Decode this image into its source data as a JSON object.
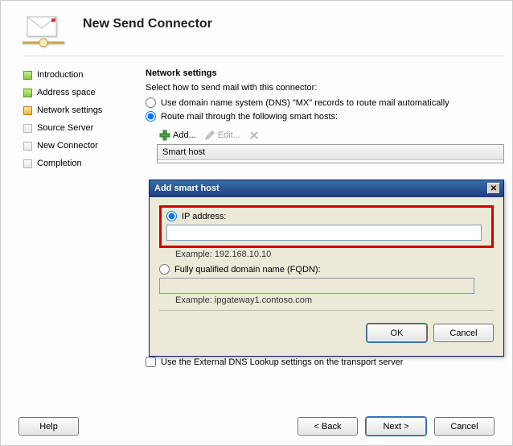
{
  "header": {
    "title": "New Send Connector"
  },
  "sidebar": {
    "steps": [
      {
        "label": "Introduction",
        "state": "green"
      },
      {
        "label": "Address space",
        "state": "green"
      },
      {
        "label": "Network settings",
        "state": "orange"
      },
      {
        "label": "Source Server",
        "state": "grey"
      },
      {
        "label": "New Connector",
        "state": "grey"
      },
      {
        "label": "Completion",
        "state": "grey"
      }
    ]
  },
  "main": {
    "section_title": "Network settings",
    "instruction": "Select how to send mail with this connector:",
    "option_dns": "Use domain name system (DNS) \"MX\" records to route mail automatically",
    "option_smart": "Route mail through the following smart hosts:",
    "toolbar": {
      "add": "Add...",
      "edit": "Edit...",
      "delete": ""
    },
    "table_header": "Smart host",
    "external_dns_label": "Use the External DNS Lookup settings on the transport server"
  },
  "dialog": {
    "title": "Add smart host",
    "ip_label": "IP address:",
    "ip_value": "",
    "ip_example": "Example: 192.168.10.10",
    "fqdn_label": "Fully qualified domain name (FQDN):",
    "fqdn_value": "",
    "fqdn_example": "Example: ipgateway1.contoso.com",
    "ok": "OK",
    "cancel": "Cancel"
  },
  "footer": {
    "help": "Help",
    "back": "< Back",
    "next": "Next >",
    "cancel": "Cancel"
  }
}
